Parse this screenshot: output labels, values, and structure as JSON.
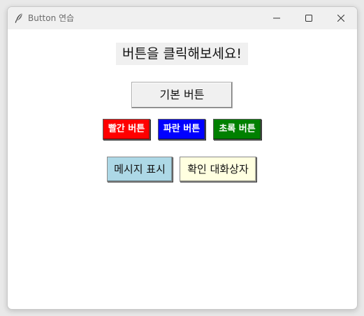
{
  "window": {
    "title": "Button 연습",
    "controls": {
      "minimize": "minimize-icon",
      "maximize": "maximize-icon",
      "close": "close-icon"
    }
  },
  "main": {
    "heading": "버튼을 클릭해보세요!",
    "default_button": "기본 버튼",
    "color_buttons": {
      "red": {
        "label": "빨간 버튼",
        "color": "#ff0000"
      },
      "blue": {
        "label": "파란 버튼",
        "color": "#0000ff"
      },
      "green": {
        "label": "초록 버튼",
        "color": "#008000"
      }
    },
    "message_buttons": {
      "show": {
        "label": "메시지 표시",
        "color": "#add8e6"
      },
      "confirm": {
        "label": "확인 대화상자",
        "color": "#ffffe0"
      }
    }
  }
}
